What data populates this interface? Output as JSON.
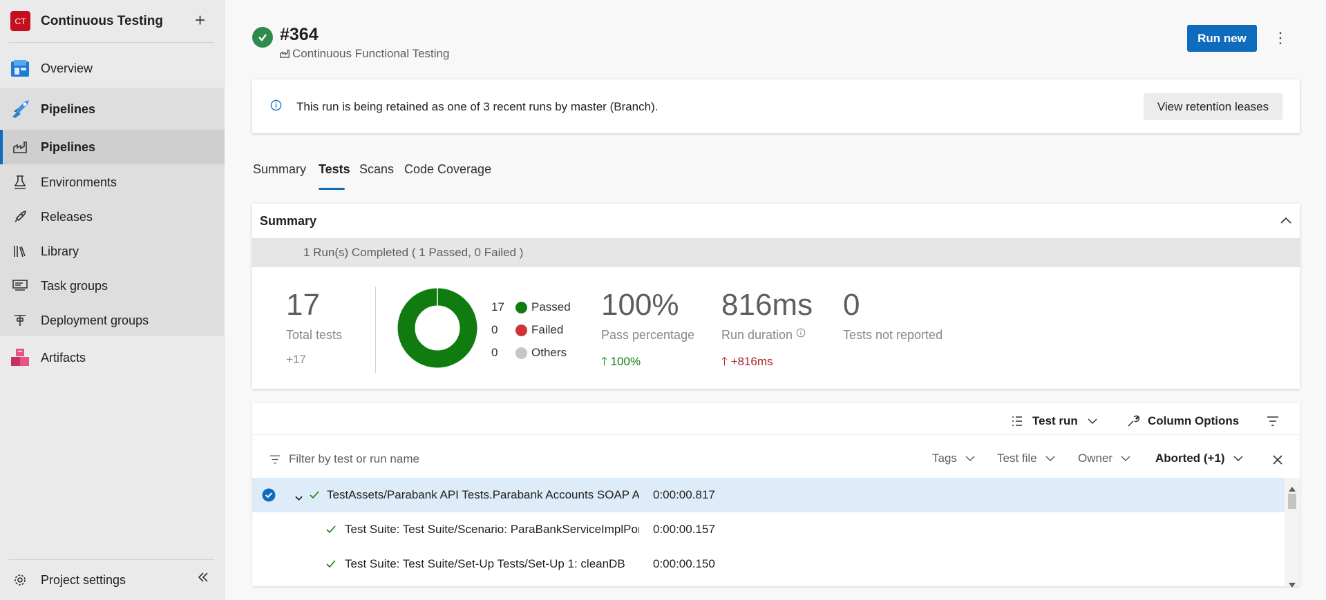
{
  "project": {
    "initials": "CT",
    "name": "Continuous Testing"
  },
  "nav": {
    "overview": "Overview",
    "pipelines_group": "Pipelines",
    "pipelines": "Pipelines",
    "environments": "Environments",
    "releases": "Releases",
    "library": "Library",
    "task_groups": "Task groups",
    "deployment_groups": "Deployment groups",
    "artifacts": "Artifacts",
    "project_settings": "Project settings"
  },
  "run": {
    "number": "#364",
    "pipeline": "Continuous Functional Testing",
    "run_new_label": "Run new"
  },
  "banner": {
    "message": "This run is being retained as one of 3 recent runs by master (Branch).",
    "button_label": "View retention leases"
  },
  "tabs": [
    "Summary",
    "Tests",
    "Scans",
    "Code Coverage"
  ],
  "active_tab": "Tests",
  "summary": {
    "title": "Summary",
    "band": "1 Run(s) Completed ( 1 Passed, 0 Failed )",
    "total_tests": "17",
    "total_tests_label": "Total tests",
    "total_tests_delta": "+17",
    "legend": [
      {
        "count": "17",
        "label": "Passed",
        "color": "#107c10"
      },
      {
        "count": "0",
        "label": "Failed",
        "color": "#d13438"
      },
      {
        "count": "0",
        "label": "Others",
        "color": "#c8c6c4"
      }
    ],
    "pass_pct": "100%",
    "pass_pct_label": "Pass percentage",
    "pass_pct_delta": "100%",
    "duration": "816ms",
    "duration_label": "Run duration",
    "duration_delta": "+816ms",
    "not_reported": "0",
    "not_reported_label": "Tests not reported"
  },
  "toolbar": {
    "test_run": "Test run",
    "column_options": "Column Options"
  },
  "filters": {
    "placeholder": "Filter by test or run name",
    "tags": "Tags",
    "test_file": "Test file",
    "owner": "Owner",
    "outcome": "Aborted (+1)"
  },
  "rows": [
    {
      "name": "TestAssets/Parabank API Tests.Parabank Accounts SOAP API",
      "duration": "0:00:00.817"
    },
    {
      "name": "Test Suite: Test Suite/Scenario: ParaBankServiceImplPort",
      "duration": "0:00:00.157"
    },
    {
      "name": "Test Suite: Test Suite/Set-Up Tests/Set-Up 1: cleanDB",
      "duration": "0:00:00.150"
    }
  ],
  "colors": {
    "accent": "#0f6cbd",
    "passed": "#107c10",
    "failed": "#d13438",
    "up_green": "#107c10",
    "up_red": "#a4262c",
    "sidebar_bg": "#eaeaea"
  }
}
